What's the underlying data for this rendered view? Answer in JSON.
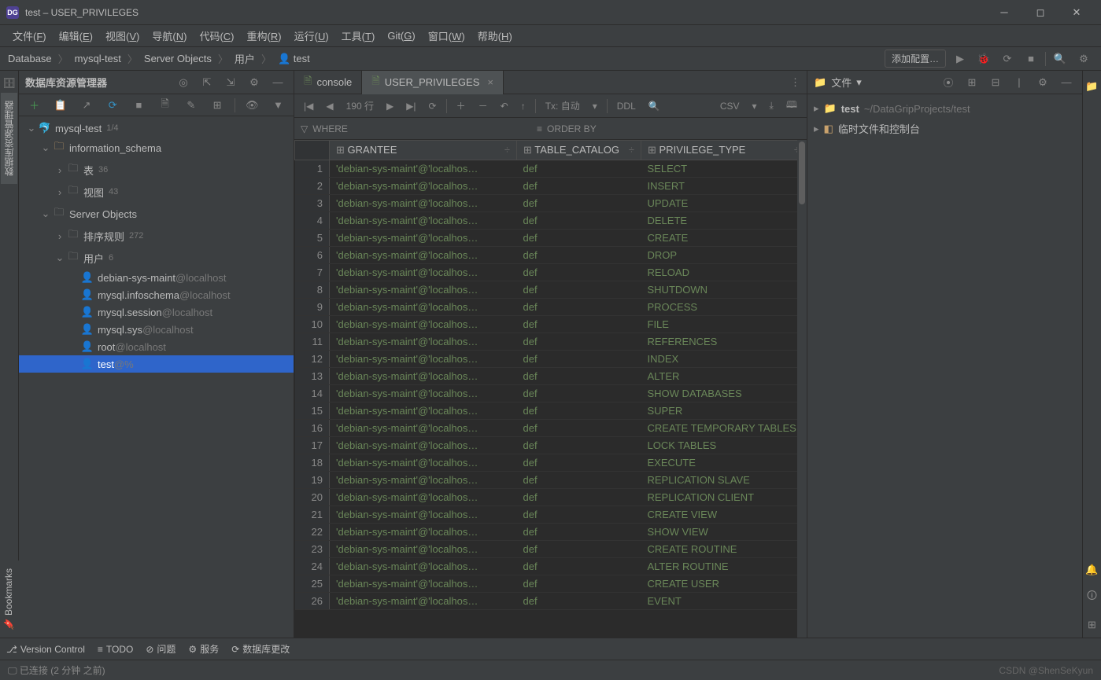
{
  "window": {
    "title": "test – USER_PRIVILEGES",
    "app_icon": "DG"
  },
  "menu": [
    "文件(F)",
    "编辑(E)",
    "视图(V)",
    "导航(N)",
    "代码(C)",
    "重构(R)",
    "运行(U)",
    "工具(T)",
    "Git(G)",
    "窗口(W)",
    "帮助(H)"
  ],
  "breadcrumb": [
    "Database",
    "mysql-test",
    "Server Objects",
    "用户",
    "test"
  ],
  "add_config": "添加配置…",
  "side_tab_left": "数据库资源管理器",
  "side_tab_bookmarks": "Bookmarks",
  "sidebar": {
    "title": "数据库资源管理器",
    "tree": {
      "root_name": "mysql-test",
      "root_count": "1/4",
      "info_schema": "information_schema",
      "tables": "表",
      "tables_count": "36",
      "views": "视图",
      "views_count": "43",
      "server_objects": "Server Objects",
      "collations": "排序规则",
      "collations_count": "272",
      "users": "用户",
      "users_count": "6",
      "user_list": [
        {
          "name": "debian-sys-maint",
          "host": "@localhost"
        },
        {
          "name": "mysql.infoschema",
          "host": "@localhost"
        },
        {
          "name": "mysql.session",
          "host": "@localhost"
        },
        {
          "name": "mysql.sys",
          "host": "@localhost"
        },
        {
          "name": "root",
          "host": "@localhost"
        },
        {
          "name": "test",
          "host": "@%"
        }
      ]
    }
  },
  "editor": {
    "tabs": [
      {
        "label": "console",
        "active": false
      },
      {
        "label": "USER_PRIVILEGES",
        "active": true
      }
    ],
    "toolbar": {
      "rows_label": "190 行",
      "tx": "Tx: 自动",
      "ddl": "DDL",
      "csv": "CSV"
    },
    "filter": {
      "where": "WHERE",
      "orderby": "ORDER BY"
    },
    "headers": [
      "GRANTEE",
      "TABLE_CATALOG",
      "PRIVILEGE_TYPE"
    ],
    "rows": [
      {
        "grantee": "'debian-sys-maint'@'localhos…",
        "catalog": "def",
        "priv": "SELECT"
      },
      {
        "grantee": "'debian-sys-maint'@'localhos…",
        "catalog": "def",
        "priv": "INSERT"
      },
      {
        "grantee": "'debian-sys-maint'@'localhos…",
        "catalog": "def",
        "priv": "UPDATE"
      },
      {
        "grantee": "'debian-sys-maint'@'localhos…",
        "catalog": "def",
        "priv": "DELETE"
      },
      {
        "grantee": "'debian-sys-maint'@'localhos…",
        "catalog": "def",
        "priv": "CREATE"
      },
      {
        "grantee": "'debian-sys-maint'@'localhos…",
        "catalog": "def",
        "priv": "DROP"
      },
      {
        "grantee": "'debian-sys-maint'@'localhos…",
        "catalog": "def",
        "priv": "RELOAD"
      },
      {
        "grantee": "'debian-sys-maint'@'localhos…",
        "catalog": "def",
        "priv": "SHUTDOWN"
      },
      {
        "grantee": "'debian-sys-maint'@'localhos…",
        "catalog": "def",
        "priv": "PROCESS"
      },
      {
        "grantee": "'debian-sys-maint'@'localhos…",
        "catalog": "def",
        "priv": "FILE"
      },
      {
        "grantee": "'debian-sys-maint'@'localhos…",
        "catalog": "def",
        "priv": "REFERENCES"
      },
      {
        "grantee": "'debian-sys-maint'@'localhos…",
        "catalog": "def",
        "priv": "INDEX"
      },
      {
        "grantee": "'debian-sys-maint'@'localhos…",
        "catalog": "def",
        "priv": "ALTER"
      },
      {
        "grantee": "'debian-sys-maint'@'localhos…",
        "catalog": "def",
        "priv": "SHOW DATABASES"
      },
      {
        "grantee": "'debian-sys-maint'@'localhos…",
        "catalog": "def",
        "priv": "SUPER"
      },
      {
        "grantee": "'debian-sys-maint'@'localhos…",
        "catalog": "def",
        "priv": "CREATE TEMPORARY TABLES"
      },
      {
        "grantee": "'debian-sys-maint'@'localhos…",
        "catalog": "def",
        "priv": "LOCK TABLES"
      },
      {
        "grantee": "'debian-sys-maint'@'localhos…",
        "catalog": "def",
        "priv": "EXECUTE"
      },
      {
        "grantee": "'debian-sys-maint'@'localhos…",
        "catalog": "def",
        "priv": "REPLICATION SLAVE"
      },
      {
        "grantee": "'debian-sys-maint'@'localhos…",
        "catalog": "def",
        "priv": "REPLICATION CLIENT"
      },
      {
        "grantee": "'debian-sys-maint'@'localhos…",
        "catalog": "def",
        "priv": "CREATE VIEW"
      },
      {
        "grantee": "'debian-sys-maint'@'localhos…",
        "catalog": "def",
        "priv": "SHOW VIEW"
      },
      {
        "grantee": "'debian-sys-maint'@'localhos…",
        "catalog": "def",
        "priv": "CREATE ROUTINE"
      },
      {
        "grantee": "'debian-sys-maint'@'localhos…",
        "catalog": "def",
        "priv": "ALTER ROUTINE"
      },
      {
        "grantee": "'debian-sys-maint'@'localhos…",
        "catalog": "def",
        "priv": "CREATE USER"
      },
      {
        "grantee": "'debian-sys-maint'@'localhos…",
        "catalog": "def",
        "priv": "EVENT"
      }
    ]
  },
  "right_panel": {
    "title": "文件",
    "project_name": "test",
    "project_path": "~/DataGripProjects/test",
    "scratch": "临时文件和控制台"
  },
  "bottom_tabs": [
    "Version Control",
    "TODO",
    "问题",
    "服务",
    "数据库更改"
  ],
  "status": {
    "text": "已连接 (2 分钟 之前)",
    "watermark": "CSDN @ShenSeKyun"
  }
}
